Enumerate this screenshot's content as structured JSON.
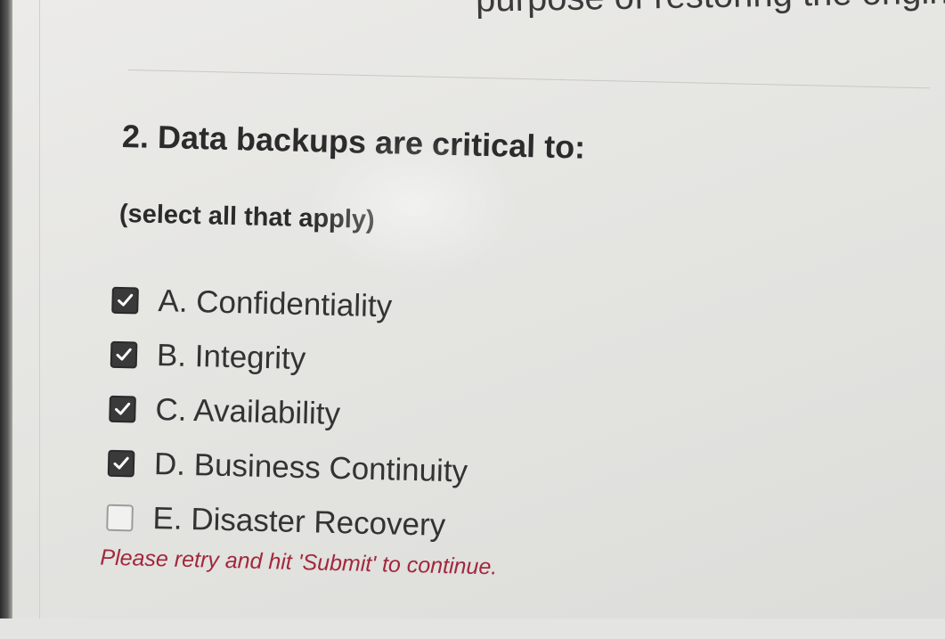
{
  "previous": {
    "text_fragment": "purpose of restoring the original data."
  },
  "question": {
    "number_and_text": "2. Data backups are critical to:",
    "instruction": "(select all that apply)"
  },
  "options": [
    {
      "label": "A. Confidentiality",
      "checked": true
    },
    {
      "label": "B. Integrity",
      "checked": true
    },
    {
      "label": "C. Availability",
      "checked": true
    },
    {
      "label": "D. Business Continuity",
      "checked": true
    },
    {
      "label": "E. Disaster Recovery",
      "checked": false
    }
  ],
  "feedback": {
    "error_text": "Please retry and hit 'Submit' to continue."
  },
  "colors": {
    "error": "#a1283c",
    "checkbox_checked": "#3a3a3a",
    "text": "#2b2b2b"
  }
}
